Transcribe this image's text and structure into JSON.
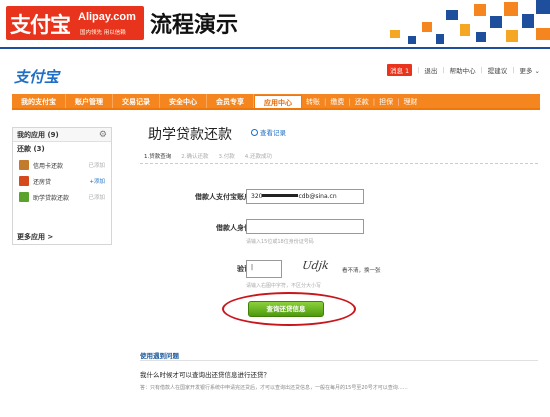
{
  "banner": {
    "logo_cn": "支付宝",
    "logo_en": "Alipay.com",
    "logo_slogan": "国内领先  用以信赖",
    "title": "流程演示"
  },
  "site": {
    "logo": "支付宝",
    "topnav": {
      "message": "消息",
      "message_count": "1",
      "logout": "退出",
      "help": "帮助中心",
      "suggest": "提建议",
      "more": "更多"
    }
  },
  "mainnav": {
    "items": [
      "我的支付宝",
      "账户管理",
      "交易记录",
      "安全中心",
      "会员专享",
      "应用中心"
    ],
    "sub_items": [
      "转账",
      "缴费",
      "还款",
      "担保",
      "理财"
    ]
  },
  "sidebar": {
    "title": "我的应用",
    "title_count": "(9)",
    "group_label": "还款",
    "group_count": "(3)",
    "items": [
      {
        "label": "信用卡还款",
        "action": "已添加",
        "icon_color": "#c47a2c"
      },
      {
        "label": "还房贷",
        "action": "+添加",
        "icon_color": "#d44a1c"
      },
      {
        "label": "助学贷款还款",
        "action": "已添加",
        "icon_color": "#5aa22c"
      }
    ],
    "more": "更多应用 >"
  },
  "main": {
    "page_title": "助学贷款还款",
    "records_link": "查看记录",
    "steps": [
      "1.贷款查询",
      "2.确认还款",
      "3.付款",
      "4.还款成功"
    ],
    "fields": {
      "account_label": "借款人支付宝账户名",
      "account_prefix": "320",
      "account_suffix": "cdb@sina.cn",
      "id_label": "借款人身份证",
      "id_hint": "请输入15位或18位身份证号码",
      "captcha_label": "验证码",
      "captcha_value": "|",
      "captcha_hint": "请输入右图中字符，不区分大小写",
      "captcha_text": "Udjk",
      "captcha_refresh": "看不清，换一张"
    },
    "submit": "查询还贷信息",
    "faq": {
      "heading": "使用遇到问题",
      "question": "我什么时候才可以查询出还贷信息进行还贷？",
      "answer": "答：只有借款人在国家开发银行系统中申请完还贷后，才可以查询出还贷信息，一般在每月的15号至20号才可以查询……"
    }
  },
  "colors": {
    "brand_red": "#e8341c",
    "nav_orange": "#f5861f",
    "button_green": "#6cb523",
    "link_blue": "#1e6fc5",
    "highlight_ring": "#c9161b"
  }
}
